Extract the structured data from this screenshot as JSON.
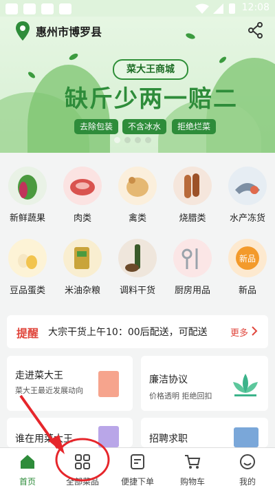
{
  "status_bar": {
    "time": "12:08"
  },
  "header": {
    "location": "惠州市博罗县",
    "icons": [
      "location-pin-icon",
      "share-icon"
    ]
  },
  "banner": {
    "badge": "菜大王商城",
    "slogan": "缺斤少两一赔二",
    "tags": [
      "去除包装",
      "不含冰水",
      "拒绝烂菜"
    ]
  },
  "categories": [
    {
      "label": "新鲜蔬果",
      "color": "#4b9a3f"
    },
    {
      "label": "肉类",
      "color": "#d9534f"
    },
    {
      "label": "禽类",
      "color": "#e5b873"
    },
    {
      "label": "烧腊类",
      "color": "#b86a3a"
    },
    {
      "label": "水产冻货",
      "color": "#7d8fa3"
    },
    {
      "label": "豆品蛋类",
      "color": "#f2c44e"
    },
    {
      "label": "米油杂粮",
      "color": "#c9a43a"
    },
    {
      "label": "调料干货",
      "color": "#6b4a2a"
    },
    {
      "label": "厨房用品",
      "color": "#9aa3ab"
    },
    {
      "label": "新品",
      "color": "#f39a2b"
    }
  ],
  "new_badge": "新品",
  "notice": {
    "tag": "提醒",
    "text": "大宗干货上午10：00后配送，可配送",
    "more": "更多"
  },
  "cards": [
    {
      "title": "走进菜大王",
      "subtitle": "菜大王最近发展动向"
    },
    {
      "title": "廉洁协议",
      "subtitle": "价格透明 拒绝回扣"
    },
    {
      "title": "谁在用菜大王",
      "subtitle": ""
    },
    {
      "title": "招聘求职",
      "subtitle": ""
    }
  ],
  "tabs": [
    {
      "label": "首页",
      "active": true
    },
    {
      "label": "全部菜品",
      "active": false
    },
    {
      "label": "便捷下单",
      "active": false
    },
    {
      "label": "购物车",
      "active": false
    },
    {
      "label": "我的",
      "active": false
    }
  ],
  "colors": {
    "brand_green": "#2e8c3a",
    "notice_red": "#e0463c"
  }
}
